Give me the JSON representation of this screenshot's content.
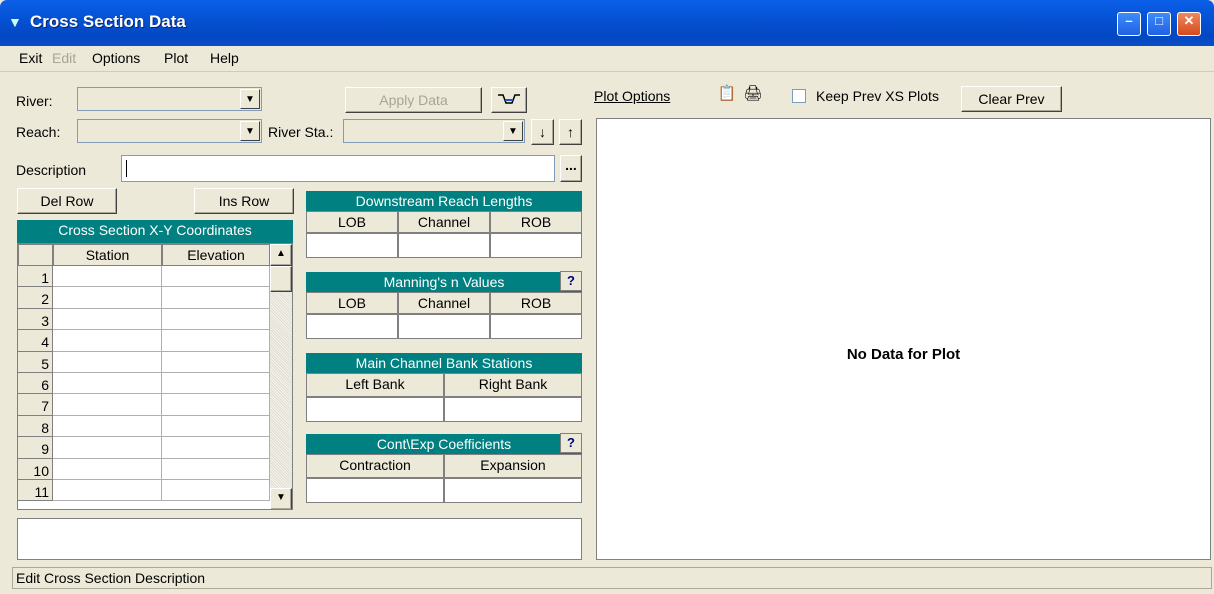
{
  "window": {
    "title": "Cross Section Data"
  },
  "menu": {
    "items": [
      {
        "label": "Exit",
        "disabled": false
      },
      {
        "label": "Edit",
        "disabled": true
      },
      {
        "label": "Options",
        "disabled": false
      },
      {
        "label": "Plot",
        "disabled": false
      },
      {
        "label": "Help",
        "disabled": false
      }
    ]
  },
  "form": {
    "river_label": "River:",
    "reach_label": "Reach:",
    "river_sta_label": "River Sta.:",
    "description_label": "Description",
    "apply_data": "Apply Data",
    "ellipsis": "...",
    "del_row": "Del Row",
    "ins_row": "Ins Row"
  },
  "xy_table": {
    "title": "Cross Section X-Y Coordinates",
    "columns": [
      "Station",
      "Elevation"
    ],
    "row_numbers": [
      "1",
      "2",
      "3",
      "4",
      "5",
      "6",
      "7",
      "8",
      "9",
      "10",
      "11"
    ]
  },
  "reach_lengths": {
    "title": "Downstream Reach Lengths",
    "columns": [
      "LOB",
      "Channel",
      "ROB"
    ]
  },
  "mannings": {
    "title": "Manning's n Values",
    "columns": [
      "LOB",
      "Channel",
      "ROB"
    ],
    "help": "?"
  },
  "bank_stations": {
    "title": "Main Channel Bank Stations",
    "columns": [
      "Left Bank",
      "Right Bank"
    ]
  },
  "coefficients": {
    "title": "Cont\\Exp  Coefficients",
    "columns": [
      "Contraction",
      "Expansion"
    ],
    "help": "?"
  },
  "plot": {
    "options_label": "Plot Options",
    "keep_prev_label": "Keep Prev XS Plots",
    "clear_prev": "Clear Prev",
    "empty_message": "No Data for Plot"
  },
  "status": {
    "text": "Edit Cross Section Description"
  }
}
